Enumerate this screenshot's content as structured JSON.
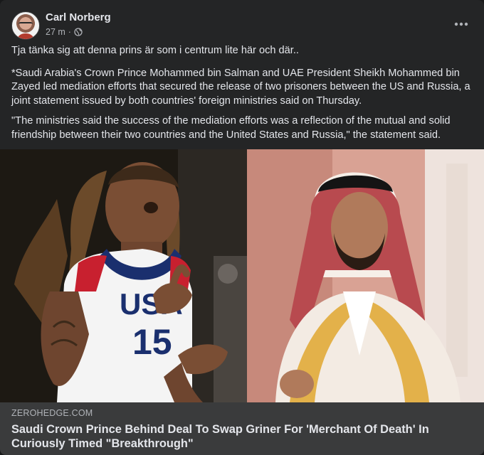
{
  "post": {
    "author": "Carl Norberg",
    "time": "27 m",
    "separator": "·",
    "privacy_icon": "globe-icon",
    "more_icon": "more-options-icon",
    "paragraphs": [
      "Tja tänka sig att denna prins är som i centrum lite här och där..",
      "*Saudi Arabia's Crown Prince Mohammed bin Salman and UAE President Sheikh Mohammed bin Zayed led mediation efforts that secured the release of two prisoners between the US and Russia, a joint statement issued by both countries' foreign ministries said on Thursday.",
      "\"The ministries said the success of the mediation efforts was a reflection of the mutual and solid friendship between their two countries and the United States and Russia,\" the statement said."
    ]
  },
  "link_preview": {
    "domain": "ZEROHEDGE.COM",
    "title": "Saudi Crown Prince Behind Deal To Swap Griner For 'Merchant Of Death' In Curiously Timed \"Breakthrough\"",
    "image_left_jersey_text": "USA",
    "image_left_jersey_number": "15"
  },
  "colors": {
    "card_bg": "#242526",
    "page_bg": "#18191a",
    "text_primary": "#e4e6eb",
    "text_secondary": "#b0b3b8",
    "link_bar_bg": "#3a3b3c"
  }
}
